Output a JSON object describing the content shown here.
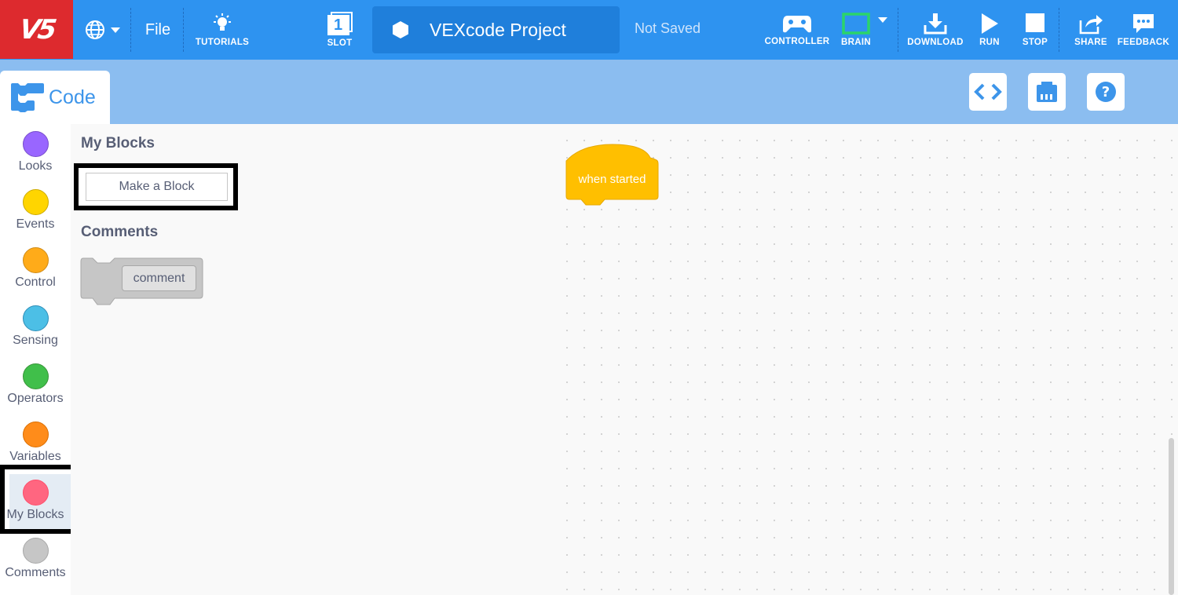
{
  "app": {
    "logo_text": "V5"
  },
  "toolbar": {
    "file_label": "File",
    "tutorials_label": "TUTORIALS",
    "slot_number": "1",
    "slot_label": "SLOT",
    "project_name": "VEXcode Project",
    "save_status": "Not Saved",
    "controller_label": "CONTROLLER",
    "brain_label": "BRAIN",
    "download_label": "DOWNLOAD",
    "run_label": "RUN",
    "stop_label": "STOP",
    "share_label": "SHARE",
    "feedback_label": "FEEDBACK"
  },
  "tabs": {
    "code_label": "Code"
  },
  "categories": [
    {
      "label": "Looks",
      "color": "#9966ff"
    },
    {
      "label": "Events",
      "color": "#ffd500"
    },
    {
      "label": "Control",
      "color": "#ffab19"
    },
    {
      "label": "Sensing",
      "color": "#4cbfe6"
    },
    {
      "label": "Operators",
      "color": "#40bf4a"
    },
    {
      "label": "Variables",
      "color": "#ff8c1a"
    },
    {
      "label": "My Blocks",
      "color": "#ff6680"
    },
    {
      "label": "Comments",
      "color": "#c6c6c6"
    }
  ],
  "flyout": {
    "my_blocks_heading": "My Blocks",
    "make_block_label": "Make a Block",
    "comments_heading": "Comments",
    "comment_block_text": "comment"
  },
  "workspace": {
    "hat_block_label": "when started",
    "hat_block_color": "#ffbf00"
  },
  "colors": {
    "topbar": "#2e93f0",
    "logo": "#dd2a2e",
    "subbar": "#8bbdf0",
    "brain_indicator": "#2bd46a"
  }
}
